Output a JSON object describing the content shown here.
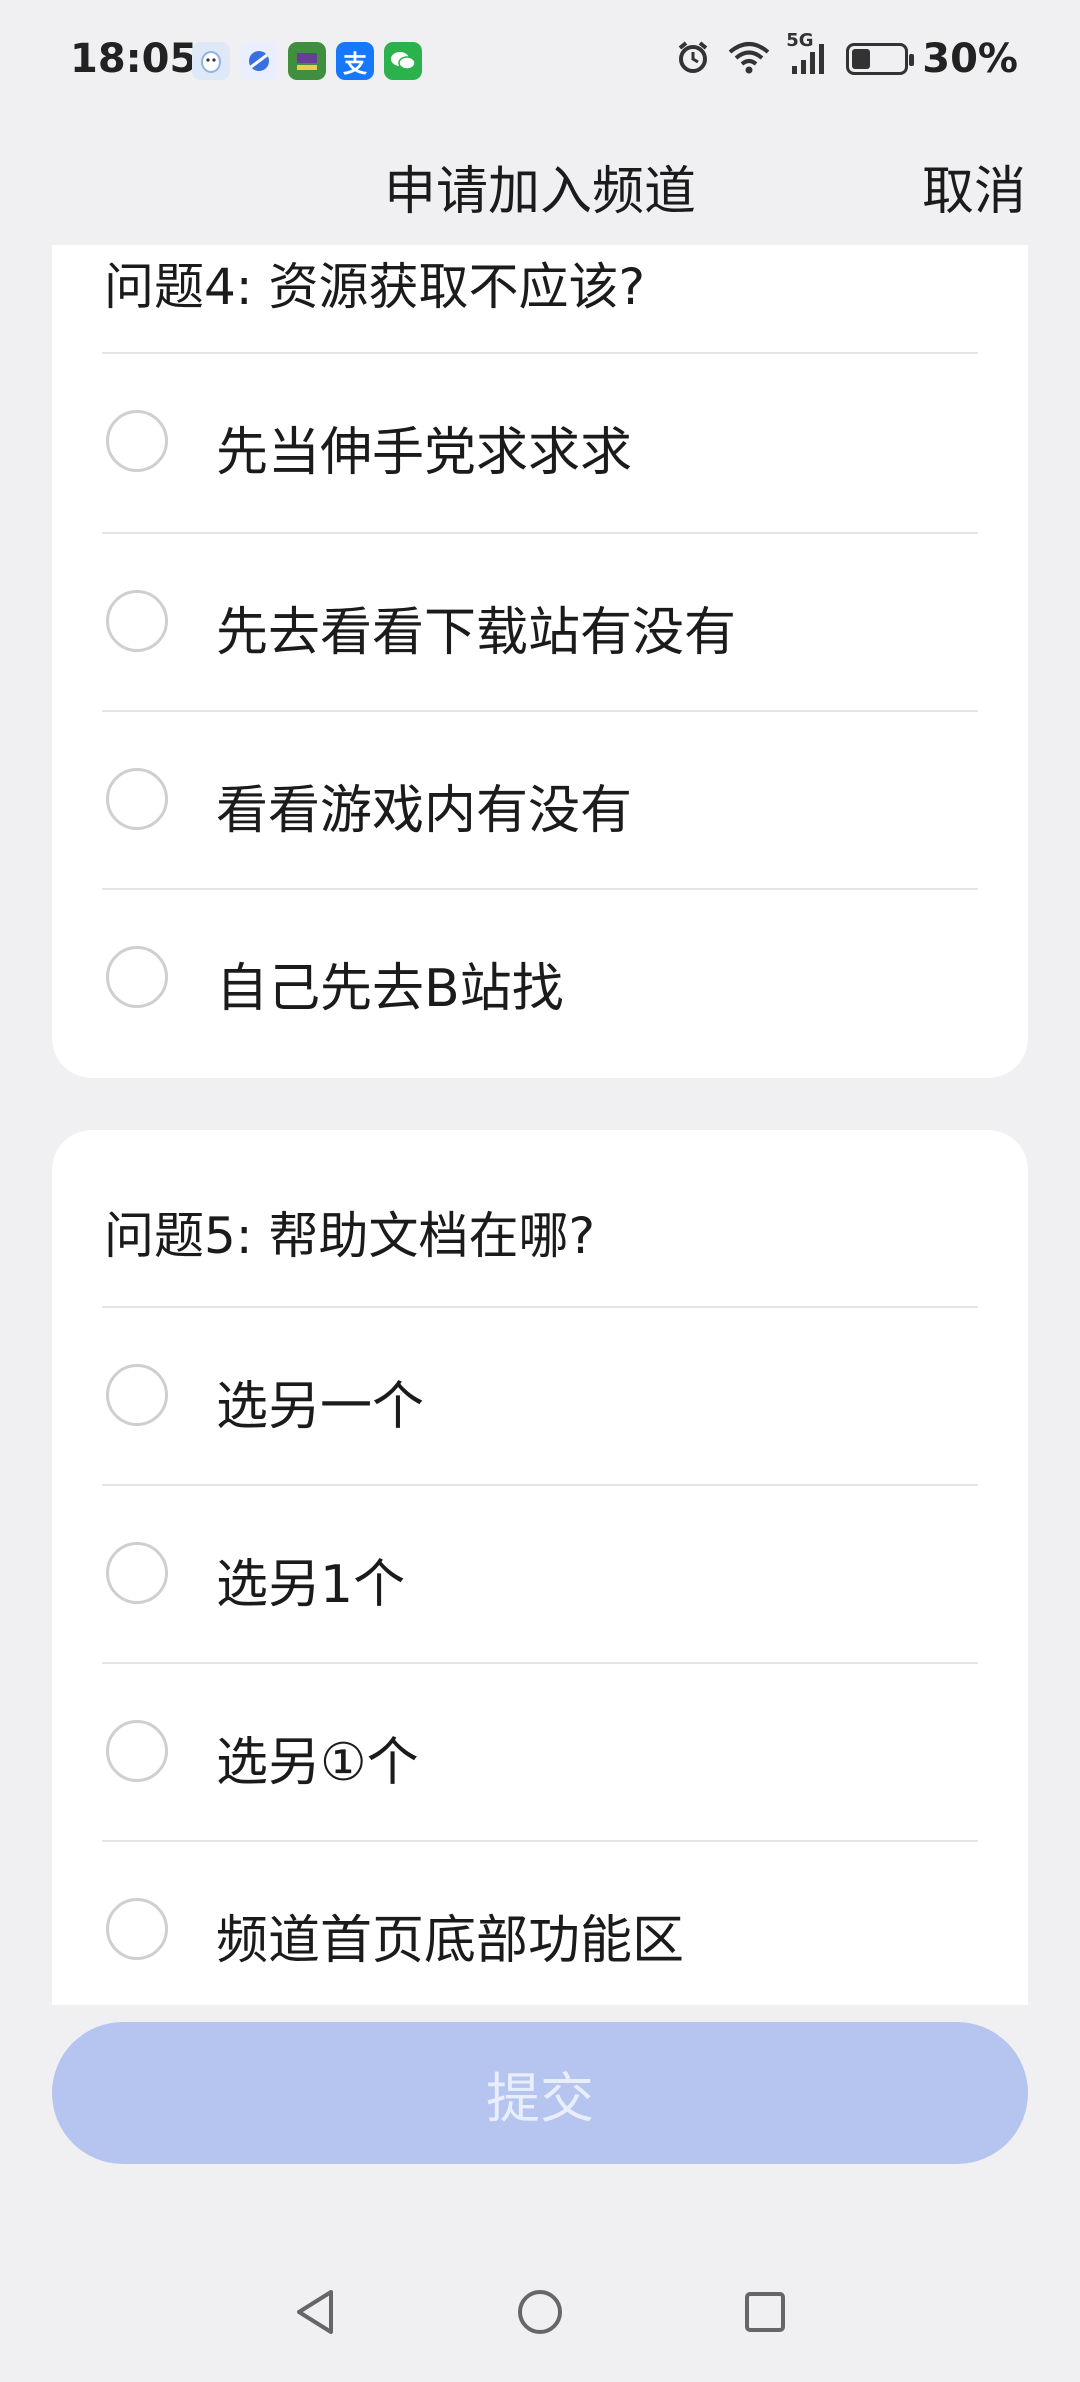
{
  "status": {
    "time": "18:05",
    "battery_pct": "30%",
    "network": "5G",
    "apps": [
      {
        "icon": "qq-icon",
        "color": "#dfe8f7"
      },
      {
        "icon": "browser-icon",
        "color": "#3a6fe3"
      },
      {
        "icon": "game-app-icon",
        "color": "#6a3c9a"
      },
      {
        "icon": "alipay-icon",
        "color": "#1677ff"
      },
      {
        "icon": "wechat-icon",
        "color": "#2bb24c"
      }
    ]
  },
  "header": {
    "title": "申请加入频道",
    "cancel_label": "取消"
  },
  "questions": [
    {
      "title": "问题4: 资源获取不应该?",
      "options": [
        "先当伸手党求求求",
        "先去看看下载站有没有",
        "看看游戏内有没有",
        "自己先去B站找"
      ]
    },
    {
      "title": "问题5: 帮助文档在哪?",
      "options": [
        "选另一个",
        "选另1个",
        "选另①个",
        "频道首页底部功能区"
      ]
    }
  ],
  "submit_label": "提交",
  "colors": {
    "background": "#f0f0f3",
    "card": "#ffffff",
    "submit_disabled": "#b6c4f0"
  }
}
